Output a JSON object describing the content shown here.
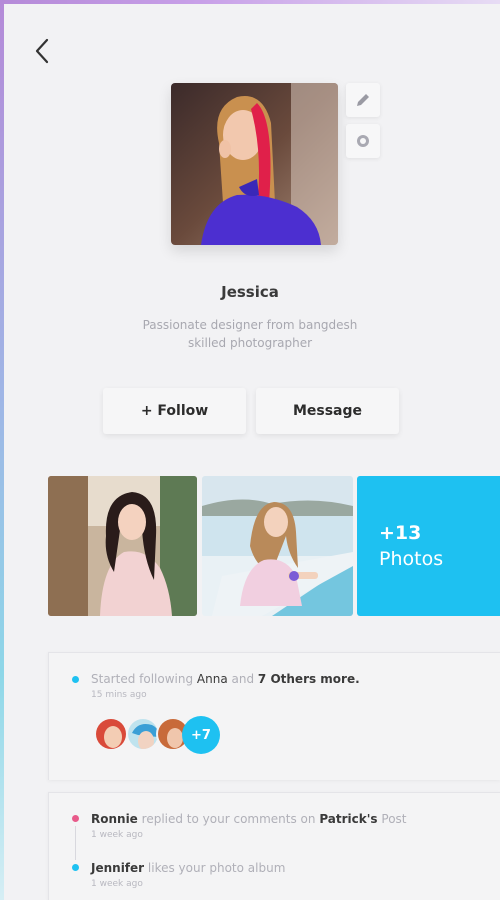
{
  "profile": {
    "name": "Jessica",
    "bio_line1": "Passionate designer from bangdesh",
    "bio_line2": "skilled photographer"
  },
  "actions": {
    "follow_label": "+ Follow",
    "message_label": "Message"
  },
  "photos": {
    "more_count": "+13",
    "more_label": "Photos"
  },
  "activity": [
    {
      "prefix": "Started following",
      "target": "Anna",
      "connector": "and",
      "others": "7 Others more.",
      "time": "15 mins ago",
      "dot_color": "#1ec1f1",
      "extra_badge": "+7"
    },
    {
      "actor": "Ronnie",
      "middle": "replied to your comments on",
      "target": "Patrick's",
      "suffix": "Post",
      "time": "1 week ago",
      "dot_color": "#e85a8a"
    },
    {
      "actor": "Jennifer",
      "middle": "likes your photo album",
      "time": "1 week ago",
      "dot_color": "#1ec1f1"
    }
  ],
  "icons": {
    "back": "chevron-left-icon",
    "edit": "pencil-icon",
    "settings": "gear-icon"
  },
  "colors": {
    "accent": "#1ec1f1",
    "background": "#f2f2f4",
    "pink_dot": "#e85a8a"
  }
}
